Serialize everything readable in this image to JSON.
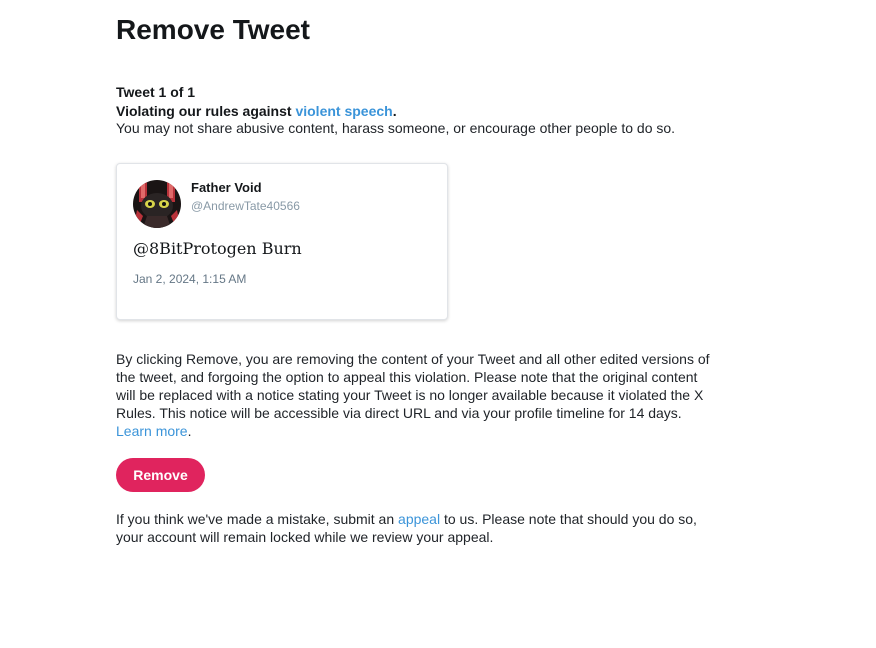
{
  "page": {
    "title": "Remove Tweet"
  },
  "violation": {
    "counter": "Tweet 1 of 1",
    "prefix": "Violating our rules against ",
    "rule_link": "violent speech",
    "suffix": ".",
    "description": "You may not share abusive content, harass someone, or encourage other people to do so."
  },
  "tweet": {
    "display_name": "Father Void",
    "handle": "@AndrewTate40566",
    "text": "@8BitProtogen Burn",
    "timestamp": "Jan 2, 2024, 1:15 AM",
    "avatar_icon": "avatar-image"
  },
  "explanation": {
    "text": "By clicking Remove, you are removing the content of your Tweet and all other edited versions of the tweet, and forgoing the option to appeal this violation. Please note that the original content will be replaced with a notice stating your Tweet is no longer available because it violated the X Rules. This notice will be accessible via direct URL and via your profile timeline for 14 days. ",
    "learn_more": "Learn more",
    "end": "."
  },
  "actions": {
    "remove_label": "Remove"
  },
  "appeal": {
    "prefix": "If you think we've made a mistake, submit an ",
    "link": "appeal",
    "suffix": " to us. Please note that should you do so, your account will remain locked while we review your appeal."
  },
  "colors": {
    "accent_link": "#3b94d9",
    "remove_button": "#e0245e",
    "text": "#14171a",
    "muted": "#8899a6"
  }
}
